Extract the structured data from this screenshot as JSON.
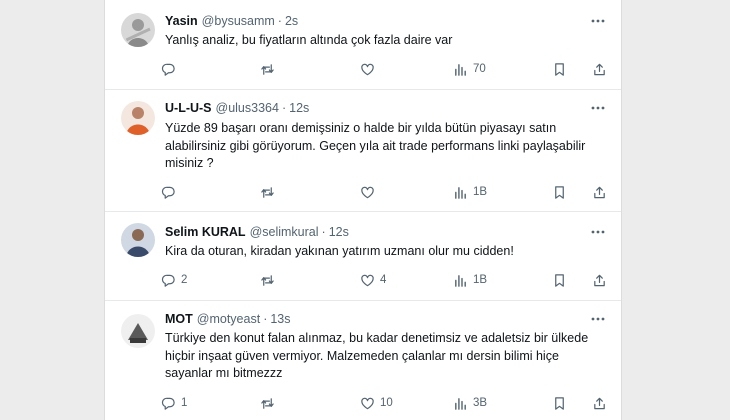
{
  "tweets": [
    {
      "name": "Yasin",
      "handle": "@bysusamm",
      "sep": "·",
      "time": "2s",
      "text": "Yanlış analiz, bu fiyatların altında çok fazla daire var",
      "replies": "",
      "retweets": "",
      "likes": "",
      "views": "70",
      "avatar_color": "#9a9a9a"
    },
    {
      "name": "U-L-U-S",
      "handle": "@ulus3364",
      "sep": "·",
      "time": "12s",
      "text": "Yüzde 89 başarı oranı demişsiniz o halde bir yılda bütün piyasayı satın alabilirsiniz gibi görüyorum. Geçen yıla ait trade performans linki paylaşabilir misiniz ?",
      "replies": "",
      "retweets": "",
      "likes": "",
      "views": "1B",
      "avatar_color": "#e0602a"
    },
    {
      "name": "Selim KURAL",
      "handle": "@selimkural",
      "sep": "·",
      "time": "12s",
      "text": "Kira da oturan, kiradan yakınan yatırım uzmanı olur mu cidden!",
      "replies": "2",
      "retweets": "",
      "likes": "4",
      "views": "1B",
      "avatar_color": "#3a4a6a"
    },
    {
      "name": "MOT",
      "handle": "@motyeast",
      "sep": "·",
      "time": "13s",
      "text": "Türkiye den konut falan alınmaz, bu kadar denetimsiz ve adaletsiz bir ülkede hiçbir inşaat güven vermiyor. Malzemeden çalanlar mı dersin bilimi hiçe sayanlar mı bitmezzz",
      "replies": "1",
      "retweets": "",
      "likes": "10",
      "views": "3B",
      "avatar_color": "#5a5a5a"
    }
  ],
  "icons": {
    "more": "more-dots-icon",
    "reply": "reply-icon",
    "retweet": "retweet-icon",
    "like": "like-icon",
    "views": "views-icon",
    "bookmark": "bookmark-icon",
    "share": "share-icon"
  }
}
